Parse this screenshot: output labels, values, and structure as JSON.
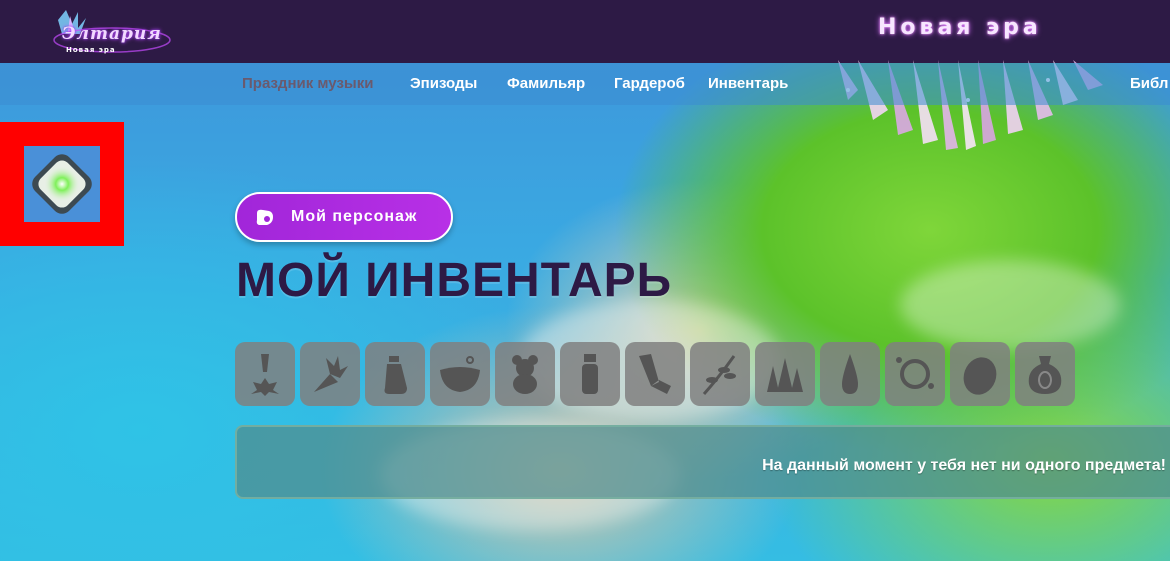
{
  "header": {
    "logo_title": "Элтария",
    "logo_subtitle": "Новая эра",
    "era_title": "Новая эра"
  },
  "nav": {
    "items": [
      {
        "label": "Праздник музыки"
      },
      {
        "label": "Эпизоды"
      },
      {
        "label": "Фамильяр"
      },
      {
        "label": "Гардероб"
      },
      {
        "label": "Инвентарь"
      },
      {
        "label": "Библ"
      }
    ]
  },
  "main": {
    "character_button": "Мой персонаж",
    "title": "МОЙ ИНВЕНТАРЬ",
    "categories": [
      {
        "icon": "quest-item-icon"
      },
      {
        "icon": "plant-icon"
      },
      {
        "icon": "potion-bottle-icon"
      },
      {
        "icon": "bowl-icon"
      },
      {
        "icon": "teddy-bear-icon"
      },
      {
        "icon": "vial-icon"
      },
      {
        "icon": "tool-icon"
      },
      {
        "icon": "herb-branch-icon"
      },
      {
        "icon": "crystal-cluster-icon"
      },
      {
        "icon": "drop-icon"
      },
      {
        "icon": "ring-icon"
      },
      {
        "icon": "egg-icon"
      },
      {
        "icon": "bag-icon"
      }
    ],
    "empty_message": "На данный момент у тебя нет ни одного предмета!"
  },
  "colors": {
    "header_bg": "#2d1a45",
    "accent_purple": "#b02edc",
    "highlight_red": "#ff0000",
    "tile_bg": "#808080"
  }
}
